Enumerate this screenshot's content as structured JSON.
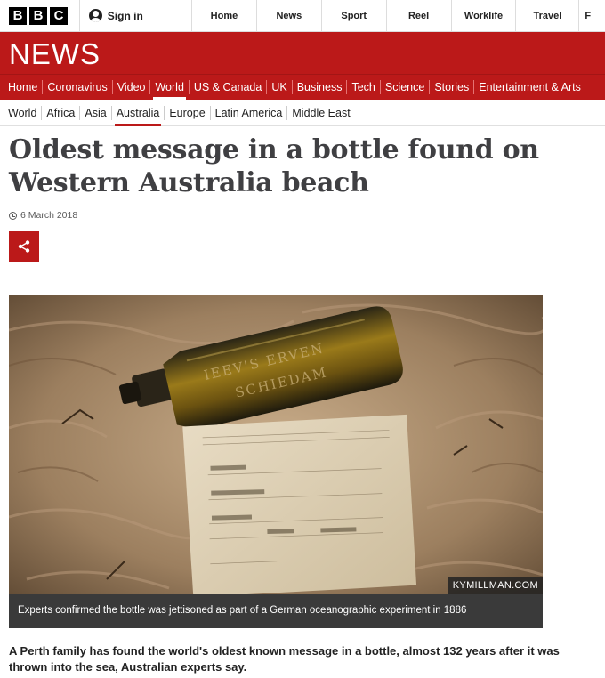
{
  "brand": {
    "letters": [
      "B",
      "B",
      "C"
    ],
    "section": "NEWS"
  },
  "signin": {
    "label": "Sign in"
  },
  "top_nav": [
    "Home",
    "News",
    "Sport",
    "Reel",
    "Worklife",
    "Travel",
    "F"
  ],
  "red_nav": {
    "items": [
      "Home",
      "Coronavirus",
      "Video",
      "World",
      "US & Canada",
      "UK",
      "Business",
      "Tech",
      "Science",
      "Stories",
      "Entertainment & Arts"
    ],
    "active": "World"
  },
  "sub_nav": {
    "items": [
      "World",
      "Africa",
      "Asia",
      "Australia",
      "Europe",
      "Latin America",
      "Middle East"
    ],
    "active": "Australia"
  },
  "article": {
    "headline": "Oldest message in a bottle found on Western Australia beach",
    "date": "6 March 2018",
    "image_credit": "KYMILLMAN.COM",
    "caption": "Experts confirmed the bottle was jettisoned as part of a German oceanographic experiment in 1886",
    "intro": "A Perth family has found the world's oldest known message in a bottle, almost 132 years after it was thrown into the sea, Australian experts say."
  },
  "colors": {
    "brand_red": "#bb1919",
    "headline": "#3f3f42"
  },
  "icons": {
    "share": "share-icon",
    "clock": "clock-icon",
    "user": "user-icon"
  }
}
